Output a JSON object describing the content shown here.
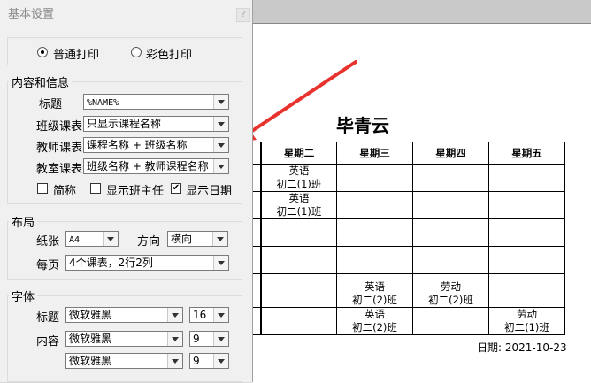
{
  "dialog": {
    "title": "基本设置",
    "close_label": "?",
    "print_mode": {
      "normal": "普通打印",
      "color": "彩色打印",
      "selected": "normal"
    },
    "content": {
      "group_label": "内容和信息",
      "title_label": "标题",
      "title_value": "%NAME%",
      "class_label": "班级课表",
      "class_value": "只显示课程名称",
      "teacher_label": "教师课表",
      "teacher_value": "课程名称 + 班级名称",
      "room_label": "教室课表",
      "room_value": "班级名称 + 教师课程名称",
      "chk_abbr": "简称",
      "chk_head": "显示班主任",
      "chk_date": "显示日期",
      "chk_abbr_checked": false,
      "chk_head_checked": false,
      "chk_date_checked": true
    },
    "layout": {
      "group_label": "布局",
      "paper_label": "纸张",
      "paper_value": "A4",
      "dir_label": "方向",
      "dir_value": "横向",
      "perpage_label": "每页",
      "perpage_value": "4个课表，2行2列"
    },
    "font": {
      "group_label": "字体",
      "title_label": "标题",
      "title_font": "微软雅黑",
      "title_size": "16",
      "content_label": "内容",
      "content_font": "微软雅黑",
      "content_size": "9",
      "extra_font": "微软雅黑",
      "extra_size": "9"
    }
  },
  "preview": {
    "name": "毕青云",
    "headers": [
      "",
      "",
      "星期二",
      "星期三",
      "星期四",
      "星期五"
    ],
    "rows": [
      [
        [
          "",
          ""
        ],
        [
          "",
          ""
        ],
        [
          "英语",
          "初二(1)班"
        ],
        [
          "",
          ""
        ],
        [
          "",
          ""
        ],
        [
          "",
          ""
        ]
      ],
      [
        [
          "",
          ""
        ],
        [
          "",
          ""
        ],
        [
          "英语",
          "初二(1)班"
        ],
        [
          "",
          ""
        ],
        [
          "",
          ""
        ],
        [
          "",
          ""
        ]
      ],
      [
        [
          "",
          ""
        ],
        [
          "",
          ""
        ],
        [
          "",
          ""
        ],
        [
          "",
          ""
        ],
        [
          "",
          ""
        ],
        [
          "",
          ""
        ]
      ],
      [
        [
          "",
          ""
        ],
        [
          "",
          ""
        ],
        [
          "",
          ""
        ],
        [
          "",
          ""
        ],
        [
          "",
          ""
        ],
        [
          "",
          ""
        ]
      ],
      [
        [
          "",
          ""
        ],
        [
          "",
          ""
        ],
        [
          "",
          ""
        ],
        [
          "英语",
          "初二(2)班"
        ],
        [
          "劳动",
          "初二(2)班"
        ],
        [
          "",
          ""
        ]
      ],
      [
        [
          "",
          ""
        ],
        [
          "",
          ""
        ],
        [
          "",
          ""
        ],
        [
          "英语",
          "初二(2)班"
        ],
        [
          "",
          ""
        ],
        [
          "劳动",
          "初二(1)班"
        ]
      ]
    ],
    "date_text": "日期: 2021-10-23"
  },
  "colors": {
    "arrow": "#e8322e"
  }
}
